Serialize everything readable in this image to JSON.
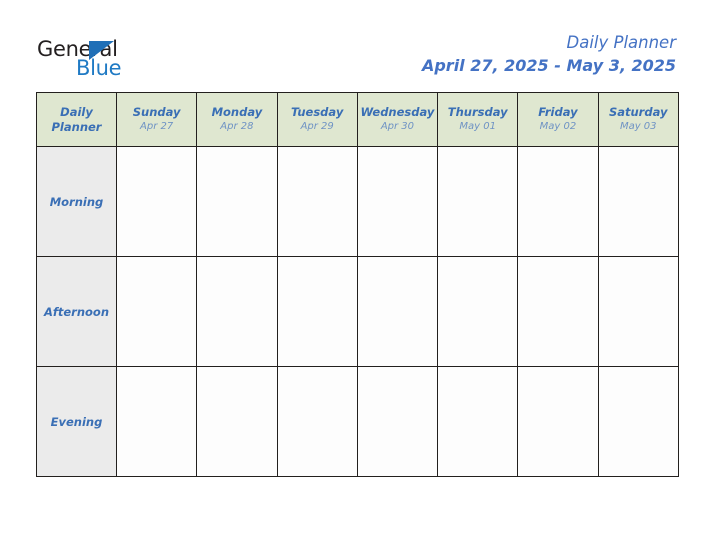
{
  "brand": {
    "logo_text_primary": "General",
    "logo_text_secondary": "Blue",
    "logo_triangle_icon": "blue-triangle-icon",
    "accent_blue": "#4472c4",
    "logo_blue": "#1f7ac4",
    "logo_dark": "#231f20"
  },
  "header": {
    "title": "Daily Planner",
    "date_range": "April 27, 2025 - May 3, 2025"
  },
  "table": {
    "corner_label_line1": "Daily",
    "corner_label_line2": "Planner",
    "header_background": "#dfe7d0",
    "row_label_background": "#ebebeb",
    "border_color": "#23201e",
    "cell_background": "#fdfdfd",
    "columns": [
      {
        "day": "Sunday",
        "date": "Apr 27"
      },
      {
        "day": "Monday",
        "date": "Apr 28"
      },
      {
        "day": "Tuesday",
        "date": "Apr 29"
      },
      {
        "day": "Wednesday",
        "date": "Apr 30"
      },
      {
        "day": "Thursday",
        "date": "May 01"
      },
      {
        "day": "Friday",
        "date": "May 02"
      },
      {
        "day": "Saturday",
        "date": "May 03"
      }
    ],
    "rows": [
      {
        "label": "Morning",
        "cells": [
          "",
          "",
          "",
          "",
          "",
          "",
          ""
        ]
      },
      {
        "label": "Afternoon",
        "cells": [
          "",
          "",
          "",
          "",
          "",
          "",
          ""
        ]
      },
      {
        "label": "Evening",
        "cells": [
          "",
          "",
          "",
          "",
          "",
          "",
          ""
        ]
      }
    ]
  }
}
